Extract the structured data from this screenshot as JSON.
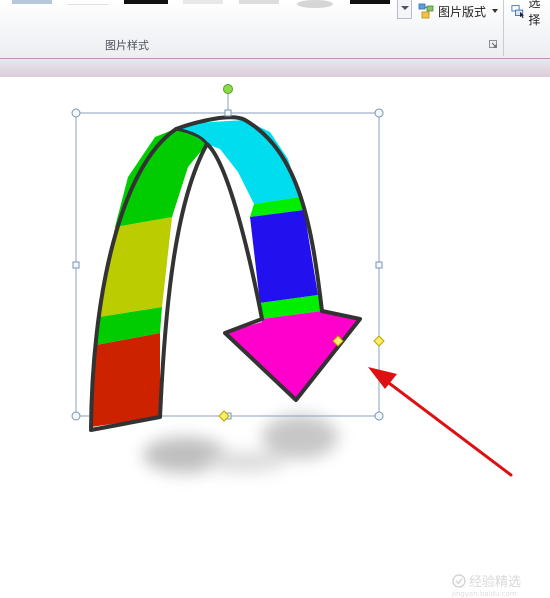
{
  "ribbon": {
    "picture_layout_label": "图片版式",
    "picture_styles_group_label": "图片样式",
    "select_label": "选择"
  },
  "icons": {
    "picture_layout": "picture-layout-icon",
    "select_pane": "selection-pane-icon",
    "dropdown": "chevron-down-icon",
    "dialog_launcher": "dialog-launcher-icon"
  },
  "colors": {
    "arrow_segments": [
      "#cc2200",
      "#00cc00",
      "#bbcc00",
      "#00cc00",
      "#00ddee",
      "#00ee00",
      "#2211ee",
      "#00ee00",
      "#ff00cc"
    ],
    "outline": "#333333",
    "selection_handle": "#8aa2c0",
    "rotation_handle": "#88dd44",
    "adjust_handle": "#ffee66",
    "annotation_arrow": "#dd1111"
  },
  "watermark": {
    "text": "经验精选",
    "url": "jingyan.baidu.com"
  }
}
